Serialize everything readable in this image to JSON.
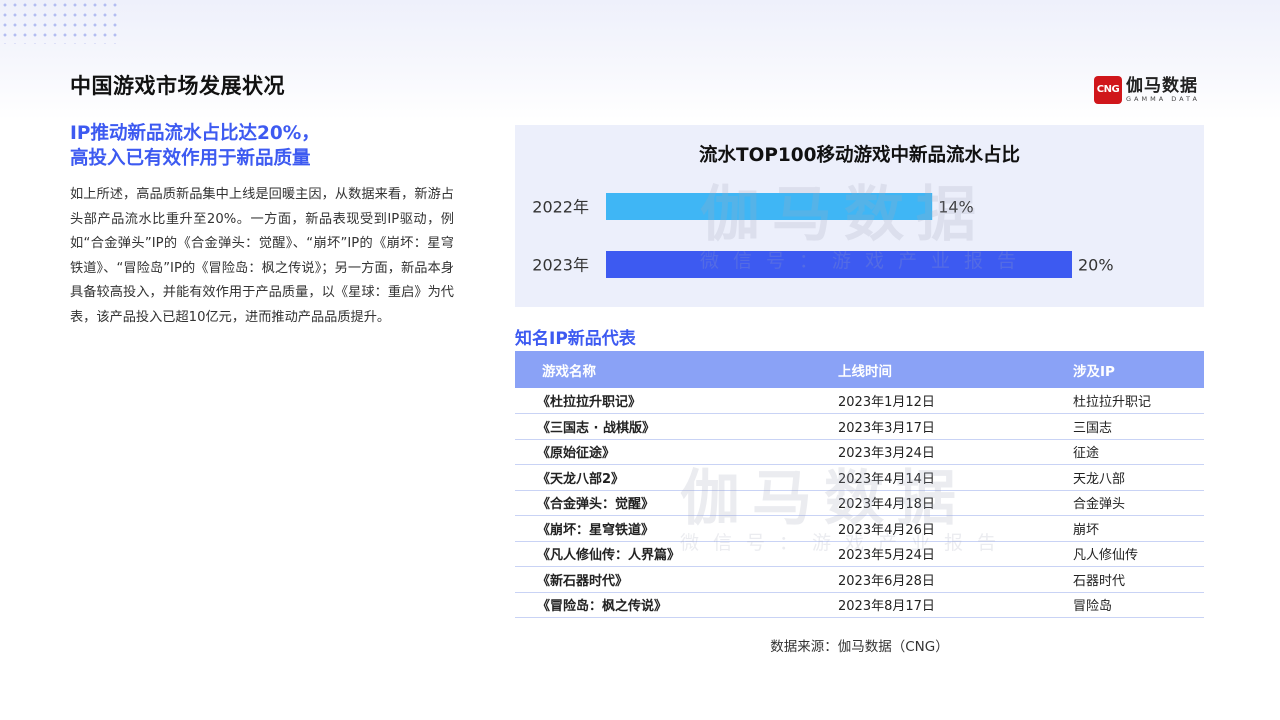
{
  "header": {
    "title": "中国游戏市场发展状况",
    "logo": {
      "mark": "CNG",
      "name_cn": "伽马数据",
      "name_en": "GAMMA DATA"
    }
  },
  "left": {
    "headline_line1": "IP推动新品流水占比达20%，",
    "headline_line2": "高投入已有效作用于新品质量",
    "body": "如上所述，高品质新品集中上线是回暖主因，从数据来看，新游占头部产品流水比重升至20%。一方面，新品表现受到IP驱动，例如“合金弹头”IP的《合金弹头：觉醒》、“崩坏”IP的《崩坏：星穹铁道》、“冒险岛”IP的《冒险岛：枫之传说》；另一方面，新品本身具备较高投入，并能有效作用于产品质量，以《星球：重启》为代表，该产品投入已超10亿元，进而推动产品品质提升。"
  },
  "watermark": {
    "big": "伽马数据",
    "small": "微信号：游戏产业报告"
  },
  "chart_data": {
    "type": "bar",
    "orientation": "horizontal",
    "title": "流水TOP100移动游戏中新品流水占比",
    "categories": [
      "2022年",
      "2023年"
    ],
    "values": [
      14,
      20
    ],
    "value_labels": [
      "14%",
      "20%"
    ],
    "unit": "%",
    "xlim": [
      0,
      20
    ],
    "colors": [
      "#3fb6f5",
      "#3d5af1"
    ],
    "grid": false,
    "legend": "none"
  },
  "table": {
    "title": "知名IP新品代表",
    "headers": [
      "游戏名称",
      "上线时间",
      "涉及IP"
    ],
    "rows": [
      [
        "《杜拉拉升职记》",
        "2023年1月12日",
        "杜拉拉升职记"
      ],
      [
        "《三国志 · 战棋版》",
        "2023年3月17日",
        "三国志"
      ],
      [
        "《原始征途》",
        "2023年3月24日",
        "征途"
      ],
      [
        "《天龙八部2》",
        "2023年4月14日",
        "天龙八部"
      ],
      [
        "《合金弹头：觉醒》",
        "2023年4月18日",
        "合金弹头"
      ],
      [
        "《崩坏：星穹铁道》",
        "2023年4月26日",
        "崩坏"
      ],
      [
        "《凡人修仙传：人界篇》",
        "2023年5月24日",
        "凡人修仙传"
      ],
      [
        "《新石器时代》",
        "2023年6月28日",
        "石器时代"
      ],
      [
        "《冒险岛：枫之传说》",
        "2023年8月17日",
        "冒险岛"
      ]
    ]
  },
  "footer": {
    "source": "数据来源：伽马数据（CNG）"
  }
}
